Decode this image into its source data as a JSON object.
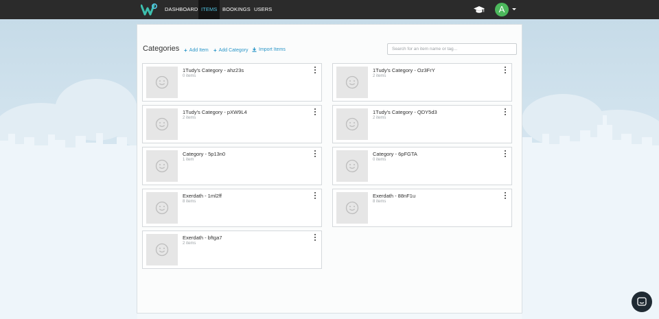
{
  "nav": {
    "items": [
      {
        "label": "DASHBOARD",
        "active": false
      },
      {
        "label": "ITEMS",
        "active": true
      },
      {
        "label": "BOOKINGS",
        "active": false
      },
      {
        "label": "USERS",
        "active": false
      }
    ],
    "avatar_initial": "A",
    "logo_icon": "w-logo-icon",
    "help_icon": "graduation-cap-icon"
  },
  "main": {
    "title": "Categories",
    "actions": {
      "add_item": "Add Item",
      "add_category": "Add Category",
      "import_items": "Import Items"
    },
    "search_placeholder": "Search for an item name or tag...",
    "categories": [
      {
        "name": "1Tudy's Category - ahz23s",
        "count": "0 items"
      },
      {
        "name": "1Tudy's Category - Oz3FrY",
        "count": "2 items"
      },
      {
        "name": "1Tudy's Category - pXW9L4",
        "count": "2 items"
      },
      {
        "name": "1Tudy's Category - QDY5d3",
        "count": "2 items"
      },
      {
        "name": "Category - 5p13n0",
        "count": "1 item"
      },
      {
        "name": "Category - 6pFGTA",
        "count": "0 items"
      },
      {
        "name": "Exerdath - 1ml2ff",
        "count": "8 items"
      },
      {
        "name": "Exerdath - 88nF1u",
        "count": "8 items"
      },
      {
        "name": "Exerdath - bftga7",
        "count": "2 items"
      }
    ]
  },
  "colors": {
    "nav_bg": "#2b2b2b",
    "active_link": "#54c7e6",
    "accent": "#2a96c8",
    "avatar": "#4cb85c"
  }
}
